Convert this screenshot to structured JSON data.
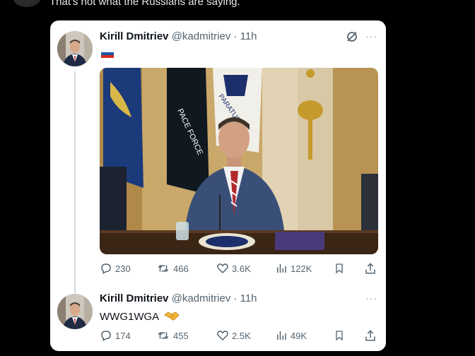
{
  "top": {
    "text": "That's not what the Russians are saying."
  },
  "tweet1": {
    "author_name": "Kirill Dmitriev",
    "handle": "@kadmitriev",
    "time": "· 11h",
    "more": "···",
    "flag_emoji": "russia-flag",
    "photo_labels": {
      "space_force_flag": "PACE FORCE",
      "flag2": "PARATUS"
    },
    "stats": {
      "replies": "230",
      "reposts": "466",
      "likes": "3.6K",
      "views": "122K"
    }
  },
  "tweet2": {
    "author_name": "Kirill Dmitriev",
    "handle": "@kadmitriev",
    "time": "· 11h",
    "more": "···",
    "text": "WWG1WGA",
    "emoji": "handshake",
    "stats": {
      "replies": "174",
      "reposts": "455",
      "likes": "2.5K",
      "views": "49K"
    }
  },
  "colors": {
    "background": "#000000",
    "card": "#ffffff",
    "muted": "#536471",
    "text": "#0f1419"
  }
}
